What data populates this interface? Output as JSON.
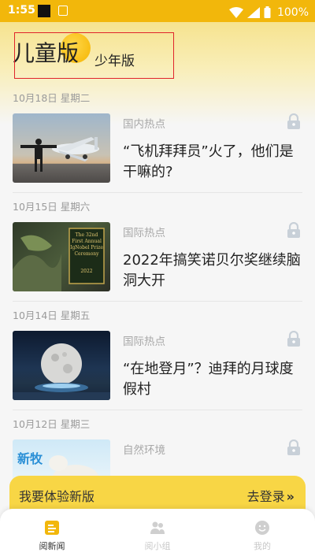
{
  "status_bar": {
    "time": "1:55",
    "battery": "100%"
  },
  "header": {
    "version_kids": "儿童版",
    "version_teen": "少年版"
  },
  "news": [
    {
      "date": "10月18日 星期二",
      "category": "国内热点",
      "title": "“飞机拜拜员”火了，他们是干嘛的?"
    },
    {
      "date": "10月15日 星期六",
      "category": "国际热点",
      "title": "2022年搞笑诺贝尔奖继续脑洞大开",
      "thumb_text": [
        "The 32nd",
        "First Annual",
        "IgNobel Prize",
        "Ceremony",
        "2022"
      ]
    },
    {
      "date": "10月14日 星期五",
      "category": "国际热点",
      "title": "“在地登月”？迪拜的月球度假村"
    },
    {
      "date": "10月12日 星期三",
      "category": "自然环境",
      "title": "",
      "thumb_text": [
        "新牧"
      ]
    }
  ],
  "promo": {
    "text": "我要体验新版",
    "login": "去登录",
    "chevron": "»"
  },
  "nav": [
    {
      "label": "阅新闻",
      "icon": "news-icon",
      "active": true
    },
    {
      "label": "阅小组",
      "icon": "group-icon",
      "active": false
    },
    {
      "label": "我的",
      "icon": "profile-icon",
      "active": false
    }
  ],
  "colors": {
    "accent": "#f2b70b",
    "banner": "#f8d645",
    "highlight": "#e0242b"
  }
}
